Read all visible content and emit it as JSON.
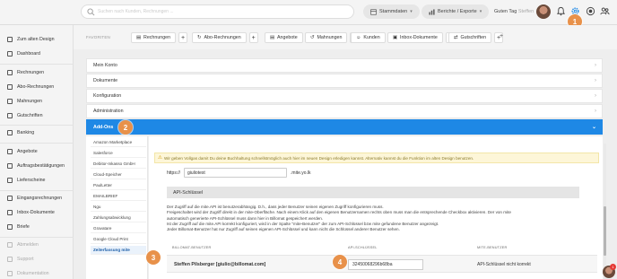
{
  "header": {
    "search_placeholder": "Suchen nach Kunden, Rechnungen ...",
    "pills": [
      {
        "label": "Stammdaten"
      },
      {
        "label": "Berichte / Exporte"
      }
    ],
    "greeting": "Guten Tag",
    "greeting_name": "Steffen",
    "icons": [
      "bell-icon",
      "settings-icon",
      "help-icon",
      "users-icon"
    ]
  },
  "callouts": [
    "1",
    "2",
    "3",
    "4"
  ],
  "sidebar": {
    "items": [
      {
        "label": "Zum alten Design",
        "icon": "back-icon"
      },
      {
        "label": "Dashboard",
        "icon": "dashboard-icon"
      },
      {
        "label": "Rechnungen",
        "icon": "invoice-icon"
      },
      {
        "label": "Abo-Rechnungen",
        "icon": "recurring-icon"
      },
      {
        "label": "Mahnungen",
        "icon": "reminder-icon"
      },
      {
        "label": "Gutschriften",
        "icon": "credit-icon"
      },
      {
        "label": "Banking",
        "icon": "bank-icon"
      },
      {
        "label": "Angebote",
        "icon": "offer-icon"
      },
      {
        "label": "Auftragsbestätigungen",
        "icon": "order-icon"
      },
      {
        "label": "Lieferscheine",
        "icon": "delivery-icon"
      },
      {
        "label": "Eingangsrechnungen",
        "icon": "incoming-icon"
      },
      {
        "label": "Inbox-Dokumente",
        "icon": "inbox-icon"
      },
      {
        "label": "Briefe",
        "icon": "letter-icon"
      },
      {
        "label": "Abmelden",
        "icon": "logout-icon"
      },
      {
        "label": "Support",
        "icon": "support-icon"
      },
      {
        "label": "Dokumentation",
        "icon": "docs-icon"
      }
    ]
  },
  "favorites": {
    "label": "FAVORITEN",
    "items": [
      {
        "label": "Rechnungen"
      },
      {
        "label": "Abo-Rechnungen"
      },
      {
        "label": "Angebote"
      },
      {
        "label": "Mahnungen"
      },
      {
        "label": "Kunden"
      },
      {
        "label": "Inbox-Dokumente"
      },
      {
        "label": "Gutschriften"
      }
    ],
    "plus": "+"
  },
  "accordion": {
    "items": [
      {
        "label": "Mein Konto"
      },
      {
        "label": "Dokumente"
      },
      {
        "label": "Konfiguration"
      },
      {
        "label": "Administration"
      },
      {
        "label": "Add-Ons"
      }
    ],
    "chevron": "›",
    "active_chevron": "⌄"
  },
  "addons": {
    "items": [
      {
        "label": "Amazon Marketplace"
      },
      {
        "label": "Salesforce"
      },
      {
        "label": "Debitor-Inkasso GmbH"
      },
      {
        "label": "Cloud-Speicher"
      },
      {
        "label": "PaulLetter"
      },
      {
        "label": "EMAILBRIEF"
      },
      {
        "label": "Ngu"
      },
      {
        "label": "Zahlungsabwicklung"
      },
      {
        "label": "Gravatare"
      },
      {
        "label": "Google Cloud Print"
      },
      {
        "label": "Zeiterfassung mite"
      }
    ]
  },
  "mite": {
    "notice": "Wir geben Vollgas damit Du deine Buchhaltung schnellstmöglich auch hier im neuen Design erledigen kannst. Alternativ kannst du die Funktion im alten Design benutzen.",
    "notice_icon": "⚠",
    "url_prefix": "https://",
    "subdomain": "giuliotest",
    "url_suffix": ".mite.yo.lk",
    "section_title": "API-Schlüssel",
    "description": [
      "Der Zugriff auf die mite.API ist benutzerabhängig. D.h., dass jeder Benutzer seinen eigenen Zugriff konfigurieren muss.",
      "Freigeschaltet wird der Zugriff direkt in der mite-Oberfläche. Nach einem Klick auf den eigenen Benutzernamen rechts oben muss man die entsprechende Checkbox aktivieren. Der von mite",
      "automatisch generierte API-Schlüssel muss dann hier in Billomat gespeichert werden.",
      "Ist der Zugriff auf die mite.API korrekt konfiguriert, wird in der Spalte \"mite-Benutzer\" der zum API-Schlüssel bzw mite gefundene Benutzer angezeigt.",
      "Jeder Billomat-Benutzer hat nur Zugriff auf seinen eigenen API-Schlüssel und kann nicht die Schlüssel anderer Benutzer sehen."
    ],
    "table": {
      "headers": [
        "BILLOMAT-BENUTZER",
        "API-SCHLÜSSEL",
        "MITE-BENUTZER"
      ],
      "rows": [
        {
          "user": "Steffen Pilsberger [giulio@billomat.com]",
          "api_key": "32450068296b68ba",
          "mite_user": "API-Schlüssel nicht korrekt"
        }
      ]
    }
  },
  "chat": {
    "badge": "1"
  }
}
